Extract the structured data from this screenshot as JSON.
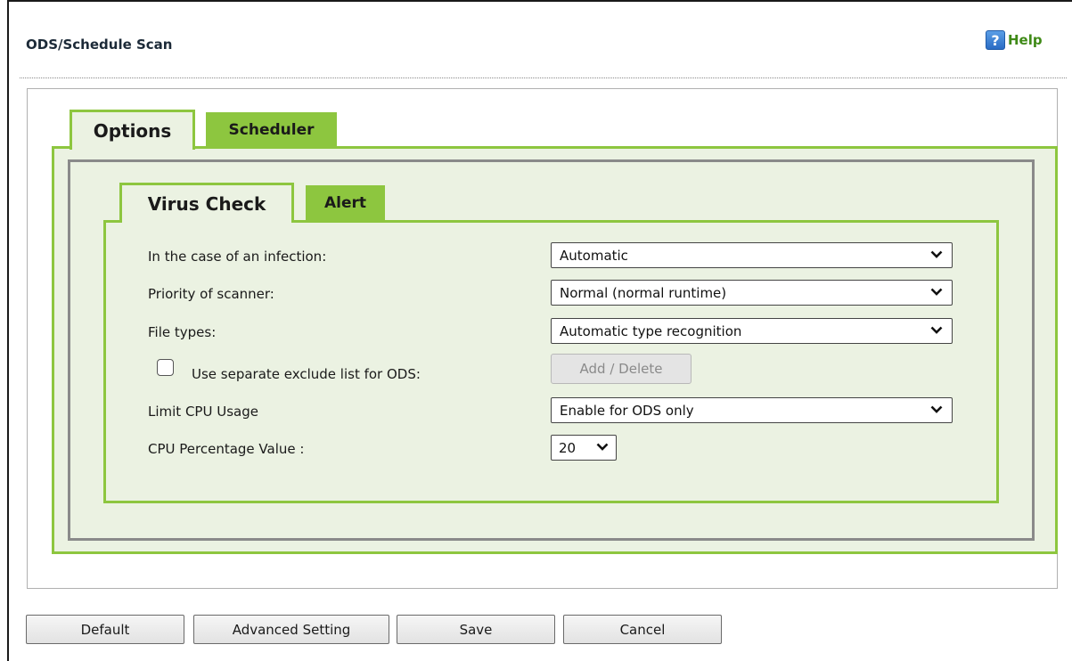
{
  "page": {
    "title": "ODS/Schedule Scan",
    "help_label": "Help",
    "help_icon_glyph": "?"
  },
  "tabs": {
    "outer": [
      {
        "label": "Options",
        "active": true
      },
      {
        "label": "Scheduler",
        "active": false
      }
    ],
    "inner": [
      {
        "label": "Virus Check",
        "active": true
      },
      {
        "label": "Alert",
        "active": false
      }
    ]
  },
  "form": {
    "infection": {
      "label": "In the case of an infection:",
      "value": "Automatic"
    },
    "priority": {
      "label": "Priority of scanner:",
      "value": "Normal (normal runtime)"
    },
    "file_types": {
      "label": "File types:",
      "value": "Automatic type recognition"
    },
    "exclude_list": {
      "label": "Use separate exclude list for ODS:",
      "checked": false,
      "button_label": "Add / Delete"
    },
    "cpu_limit": {
      "label": "Limit CPU Usage",
      "value": "Enable for ODS only"
    },
    "cpu_percent": {
      "label": "CPU Percentage Value :",
      "value": "20"
    }
  },
  "buttons": {
    "default": "Default",
    "advanced": "Advanced Setting",
    "save": "Save",
    "cancel": "Cancel"
  },
  "icons": {
    "help": "help-question-icon",
    "select_arrow": "chevron-down-icon"
  },
  "colors": {
    "accent_green": "#8dc63f",
    "panel_bg": "#ebf2e2",
    "help_text": "#3f8a17",
    "help_icon": "#2b6cc4"
  }
}
